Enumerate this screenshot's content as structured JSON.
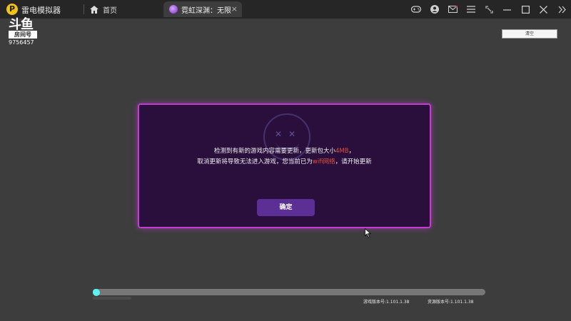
{
  "app": {
    "title": "雷电模拟器",
    "logo_glyph": "P"
  },
  "tabs": {
    "home_label": "首页",
    "game_label": "霓虹深渊：无限",
    "close_glyph": "×"
  },
  "watermark": {
    "logo_text": "斗鱼",
    "badge_text": "房间号",
    "room_id": "9756457"
  },
  "toolbar": {
    "clear_label": "清空"
  },
  "dialog": {
    "line1_prefix": "检测到有新的游戏内容需要更新，更新包大小",
    "line1_size": "4MB",
    "line1_suffix": "，",
    "line2_prefix": "取消更新将导致无法进入游戏，您当前已为",
    "line2_network": "wifi网络",
    "line2_suffix": "，请开始更新",
    "confirm_label": "确定",
    "highlight_color": "#e0513b"
  },
  "progress": {
    "value_fraction": 0.01
  },
  "versions": {
    "game": "游戏版本号:1.101.1.38",
    "resource": "资源版本号:1.101.1.38"
  },
  "colors": {
    "dialog_border": "#c53bd4",
    "dialog_bg": "#2a0f3d",
    "button": "#5c2f97",
    "progress_fill": "#3ee6e6"
  }
}
